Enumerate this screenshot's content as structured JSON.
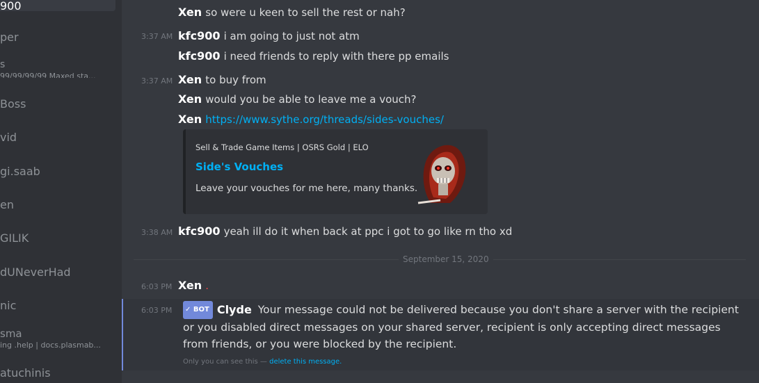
{
  "sidebar": {
    "items": [
      {
        "name": "900",
        "sub": "",
        "active": true
      },
      {
        "name": "per",
        "sub": ""
      },
      {
        "name": "s",
        "sub": "99/99/99/99 Maxed sta..."
      },
      {
        "name": "Boss",
        "sub": ""
      },
      {
        "name": "vid",
        "sub": ""
      },
      {
        "name": "gi.saab",
        "sub": ""
      },
      {
        "name": "en",
        "sub": ""
      },
      {
        "name": "GILIK",
        "sub": ""
      },
      {
        "name": "dUNeverHad",
        "sub": ""
      },
      {
        "name": "nic",
        "sub": ""
      },
      {
        "name": "sma",
        "sub": "ing .help | docs.plasmab..."
      },
      {
        "name": "atuchinis",
        "sub": ""
      }
    ]
  },
  "messages": {
    "m1": {
      "author": "Xen",
      "text": "so were u keen to sell the rest or nah?"
    },
    "m2": {
      "time": "3:37 AM",
      "author": "kfc900",
      "text": "i am going to just not atm"
    },
    "m3": {
      "author": "kfc900",
      "text": "i need friends to reply with there pp emails"
    },
    "m4": {
      "time": "3:37 AM",
      "author": "Xen",
      "text": "to buy from"
    },
    "m5": {
      "author": "Xen",
      "text": "would you be able to leave me a vouch?"
    },
    "m6": {
      "author": "Xen",
      "link": "https://www.sythe.org/threads/sides-vouches/"
    },
    "embed": {
      "provider": "Sell & Trade Game Items | OSRS Gold | ELO",
      "title": "Side's Vouches",
      "description": "Leave your vouches for me here, many thanks."
    },
    "m7": {
      "time": "3:38 AM",
      "author": "kfc900",
      "text": "yeah ill do it when back at ppc i got to go like rn tho xd"
    },
    "divider": "September 15, 2020",
    "m8": {
      "time": "6:03 PM",
      "author": "Xen",
      "text": "."
    },
    "clyde": {
      "time": "6:03 PM",
      "bot_tag": "BOT",
      "bot_check": "✓",
      "author": "Clyde",
      "text": "Your message could not be delivered because you don't share a server with the recipient or you disabled direct messages on your shared server, recipient is only accepting direct messages from friends, or you were blocked by the recipient.",
      "ephemeral_note": "Only you can see this —",
      "delete_link": "delete this message",
      "delete_suffix": "."
    }
  },
  "colors": {
    "background": "#36393f",
    "sidebar": "#2f3136",
    "link": "#00b0f4",
    "bot_tag": "#7289da"
  }
}
